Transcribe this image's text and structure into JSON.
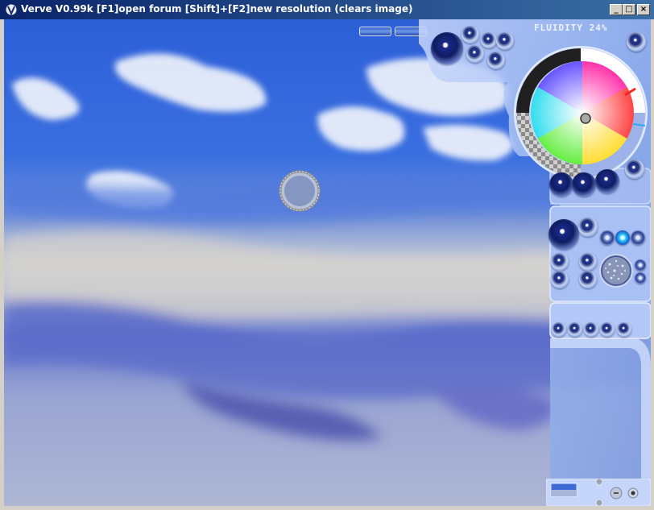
{
  "window": {
    "title": "Verve V0.99k [F1]open forum   [Shift]+[F2]new resolution (clears image)",
    "minimize_glyph": "_",
    "maximize_glyph": "□",
    "close_glyph": "×"
  },
  "toolbar": {
    "fluidity_label": "FLUIDITY 24%"
  },
  "colors": {
    "title_gradient_start": "#0a246a",
    "title_gradient_end": "#3a6ea5",
    "panel_blue": "#9fbaf0",
    "sky_blue": "#2f60d6"
  },
  "icons": [
    "app-icon",
    "color-wheel",
    "brush-cursor-icon",
    "preset-swatch-icon"
  ]
}
